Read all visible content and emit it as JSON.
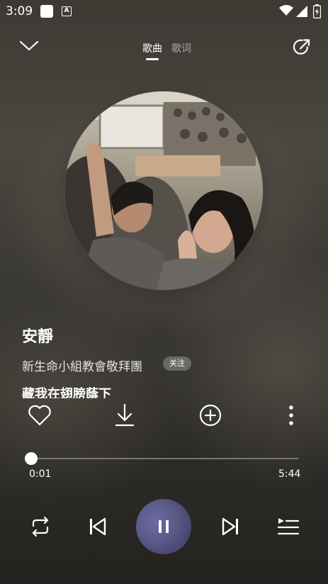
{
  "status_bar": {
    "time": "3:09",
    "notif_letter": "A"
  },
  "header": {
    "tabs": [
      {
        "label": "歌曲",
        "active": true
      },
      {
        "label": "歌词",
        "active": false
      }
    ]
  },
  "song": {
    "title": "安靜",
    "artist": "新生命小組教會敬拜團",
    "follow_label": "关注",
    "lyric_line": "藏我在翅膀蔭下"
  },
  "progress": {
    "current": "0:01",
    "total": "5:44",
    "fraction": 0.0
  },
  "playback": {
    "state": "playing"
  },
  "colors": {
    "accent_play": "#5b5a8a",
    "text": "#ffffff"
  },
  "icons": {
    "collapse": "chevron-down-icon",
    "share": "share-icon",
    "like": "heart-icon",
    "download": "download-icon",
    "add": "add-circle-icon",
    "more": "more-vert-icon",
    "repeat": "repeat-icon",
    "prev": "skip-previous-icon",
    "play_pause": "pause-icon",
    "next": "skip-next-icon",
    "queue": "playlist-icon"
  }
}
